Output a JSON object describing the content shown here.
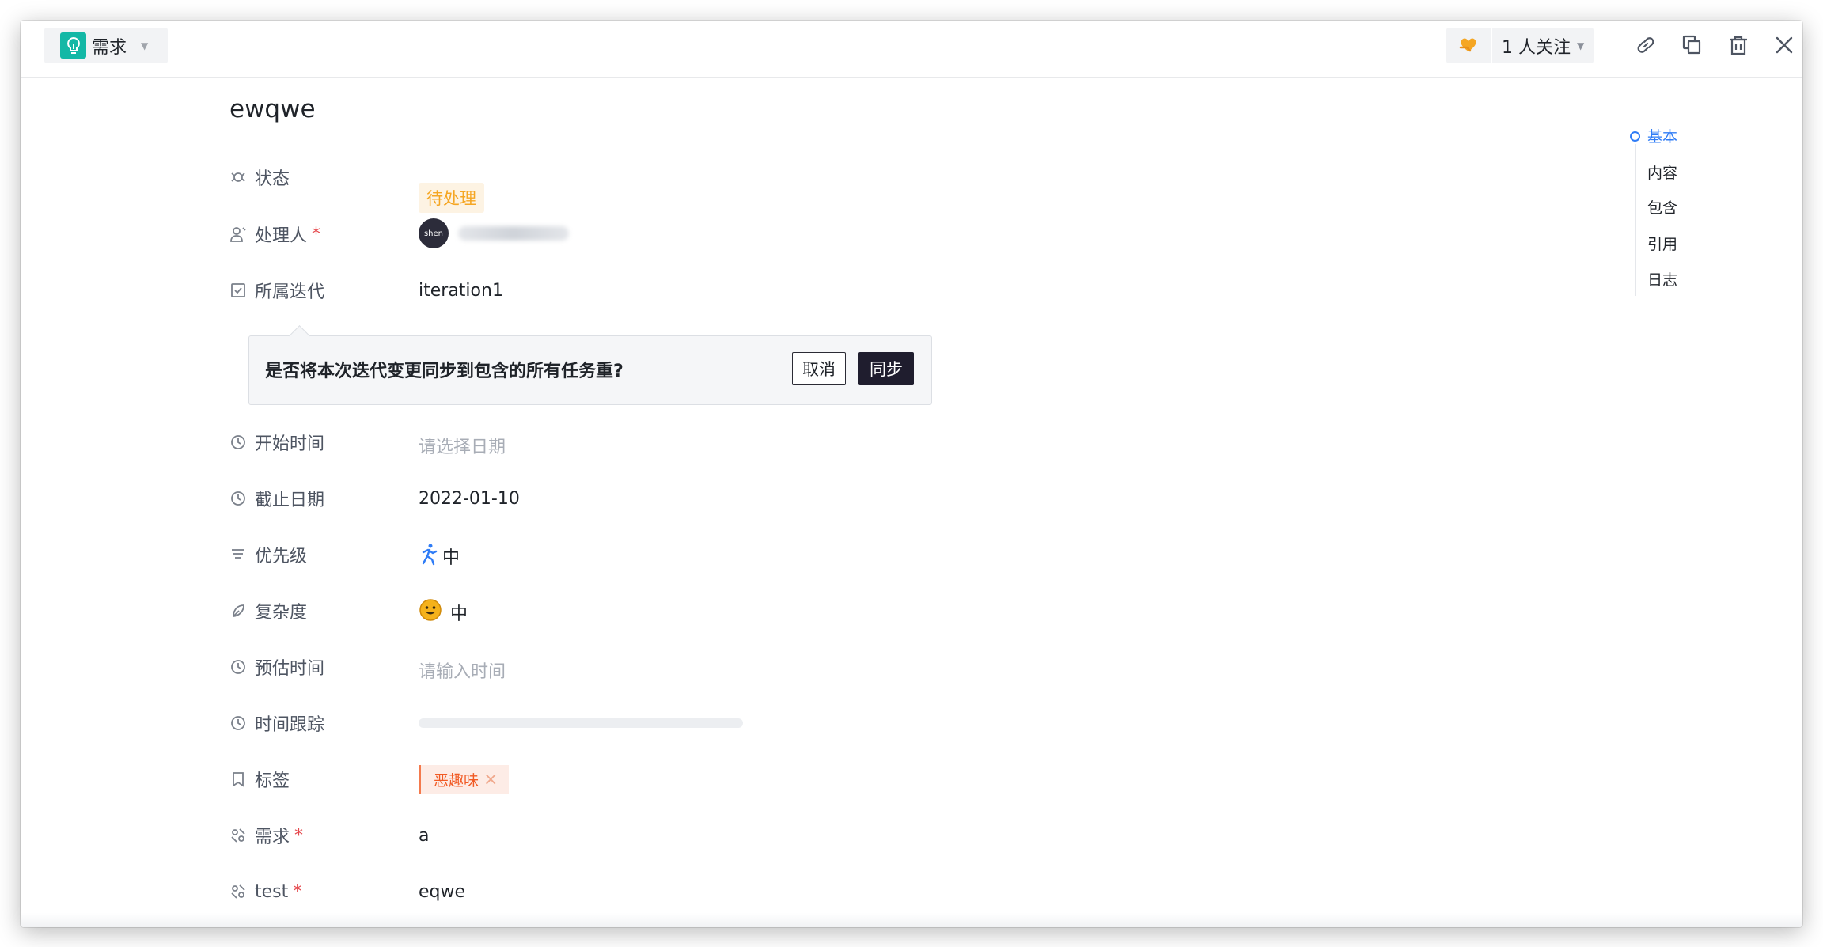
{
  "topbar": {
    "type_label": "需求",
    "type_icon": "bulb-icon",
    "follow_label": "1 人关注",
    "follow_icon": "heart-hand-icon",
    "tools": [
      "link-icon",
      "copy-icon",
      "trash-icon",
      "close-icon"
    ]
  },
  "title": "ewqwe",
  "fields": {
    "status": {
      "label": "状态",
      "value": "待处理"
    },
    "assignee": {
      "label": "处理人",
      "required": "*",
      "avatar_text": "shen"
    },
    "iteration": {
      "label": "所属迭代",
      "value": "iteration1"
    },
    "start_time": {
      "label": "开始时间",
      "placeholder": "请选择日期"
    },
    "due_date": {
      "label": "截止日期",
      "value": "2022-01-10"
    },
    "priority": {
      "label": "优先级",
      "value": "中",
      "icon": "running-person-icon"
    },
    "complexity": {
      "label": "复杂度",
      "value": "中",
      "icon": "smile-emoji-icon"
    },
    "estimate": {
      "label": "预估时间",
      "placeholder": "请输入时间"
    },
    "time_tracking": {
      "label": "时间跟踪",
      "progress": 0
    },
    "tags": {
      "label": "标签",
      "items": [
        "恶趣味"
      ]
    },
    "requirement": {
      "label": "需求",
      "required": "*",
      "value": "a"
    },
    "test": {
      "label": "test",
      "required": "*",
      "value": "eqwe"
    }
  },
  "popconfirm": {
    "message": "是否将本次迭代变更同步到包含的所有任务重?",
    "cancel_label": "取消",
    "confirm_label": "同步"
  },
  "anchor_nav": {
    "items": [
      "基本",
      "内容",
      "包含",
      "引用",
      "日志"
    ],
    "active": "基本"
  },
  "colors": {
    "accent": "#2f7cf6",
    "status": "#f5a623",
    "tag": "#f15a24",
    "type_icon_bg": "#14b8a6",
    "primary_button": "#1f1d2e"
  }
}
